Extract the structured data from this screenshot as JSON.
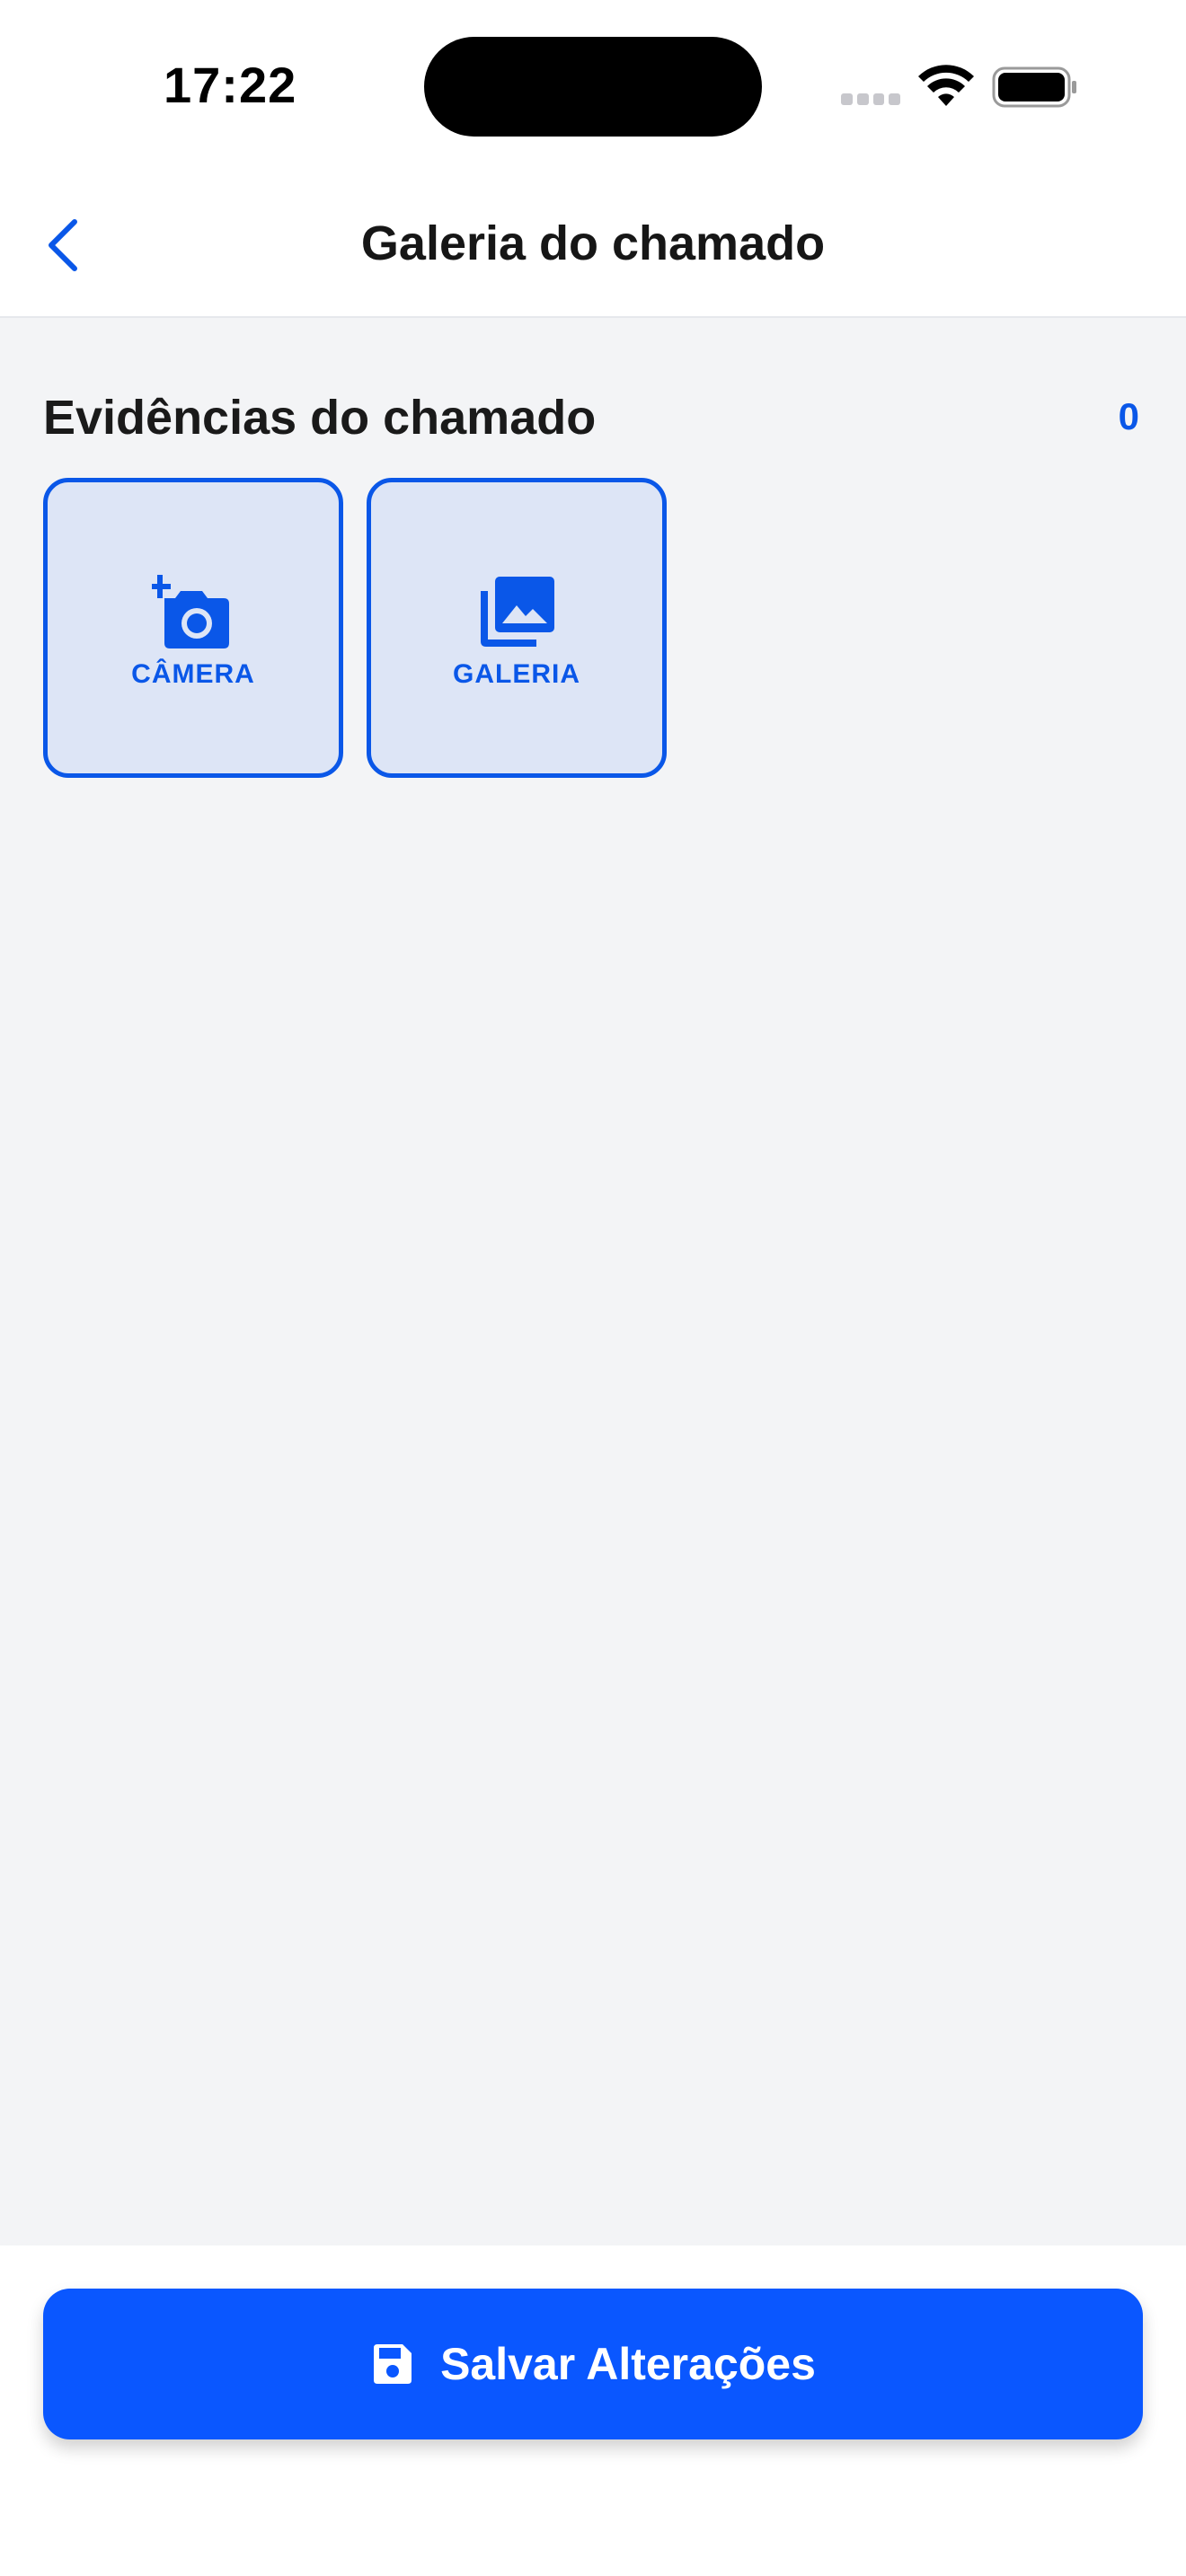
{
  "status_bar": {
    "time": "17:22"
  },
  "header": {
    "title": "Galeria do chamado",
    "back_icon": "chevron-left-icon"
  },
  "section": {
    "title": "Evidências do chamado",
    "count": "0"
  },
  "tiles": [
    {
      "label": "CÂMERA",
      "icon": "add-a-photo-icon"
    },
    {
      "label": "GALERIA",
      "icon": "photo-library-icon"
    }
  ],
  "footer": {
    "save_label": "Salvar Alterações",
    "save_icon": "save-icon"
  },
  "colors": {
    "accent": "#0a57ff",
    "tile_background": "#dde5f6",
    "page_background": "#f3f4f6"
  }
}
